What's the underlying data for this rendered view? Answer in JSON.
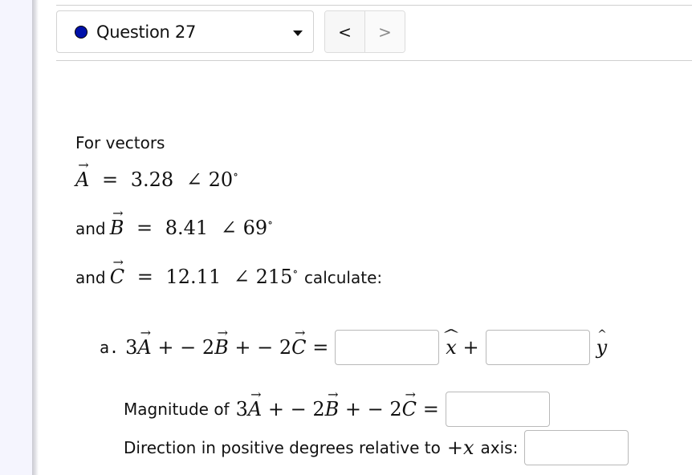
{
  "nav": {
    "question_label": "Question 27",
    "status_dot_color": "#0011aa",
    "prev_label": "<",
    "next_label": ">"
  },
  "problem": {
    "intro": "For vectors",
    "vectors": [
      {
        "prefix": "",
        "name": "A",
        "magnitude": "3.28",
        "angle": "20",
        "suffix": ""
      },
      {
        "prefix": "and",
        "name": "B",
        "magnitude": "8.41",
        "angle": "69",
        "suffix": ""
      },
      {
        "prefix": "and",
        "name": "C",
        "magnitude": "12.11",
        "angle": "215",
        "suffix": "calculate:"
      }
    ],
    "part_a": {
      "label": "a.",
      "coeffs": [
        "3",
        "− 2",
        "− 2"
      ],
      "plus": "+",
      "equals": "=",
      "x_unit": "x",
      "y_unit": "y",
      "x_value": "",
      "y_value": ""
    },
    "magnitude": {
      "label": "Magnitude of",
      "value": ""
    },
    "direction": {
      "label_before": "Direction in positive degrees relative to",
      "axis_sign": "+",
      "axis_var": "x",
      "label_after": "axis:",
      "value": ""
    },
    "symbols": {
      "angle": "∠",
      "degree": "∘",
      "equals": "="
    }
  }
}
